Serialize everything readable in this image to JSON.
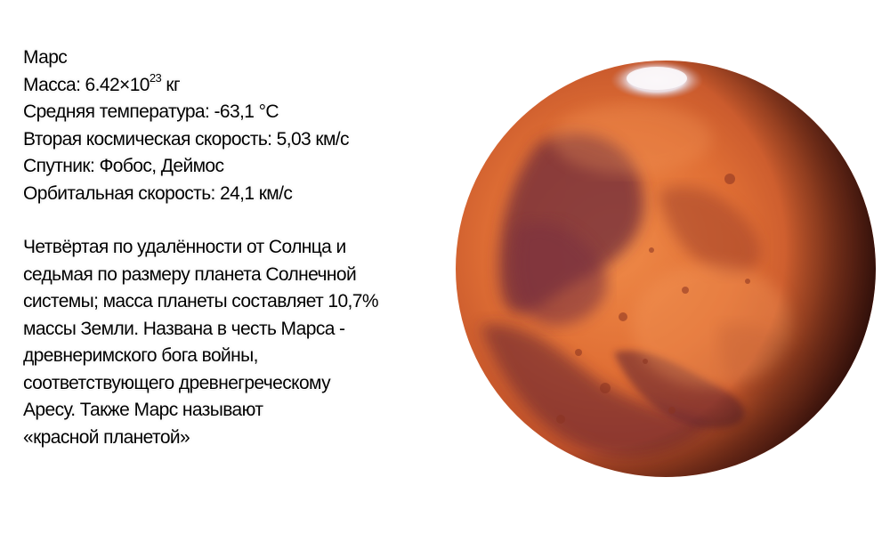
{
  "facts": {
    "name": "Марс",
    "mass_prefix": "Масса: 6.42×10",
    "mass_exp": "23",
    "mass_unit": " кг",
    "temperature": "Средняя температура: -63,1 °C",
    "escape_velocity": "Вторая космическая скорость: 5,03 км/с",
    "satellites": "Спутник: Фобос, Деймос",
    "orbital_velocity": "Орбитальная скорость: 24,1 км/с"
  },
  "description": {
    "lines": [
      "Четвёртая по удалённости от Солнца и",
      "седьмая по размеру планета Солнечной",
      "системы; масса планеты составляет 10,7%",
      "массы Земли. Названа в честь Марса -",
      "древнеримского бога войны,",
      "соответствующего древнегреческому",
      "Аресу. Также Марс называют",
      "«красной планетой»"
    ]
  },
  "image": {
    "subject": "planet-mars",
    "colors": {
      "surface_light": "#e8783a",
      "surface_mid": "#c24e24",
      "dark_regions": "#6e2a3a",
      "polar_cap": "#f2eef0",
      "shadow": "#1a0806"
    }
  }
}
